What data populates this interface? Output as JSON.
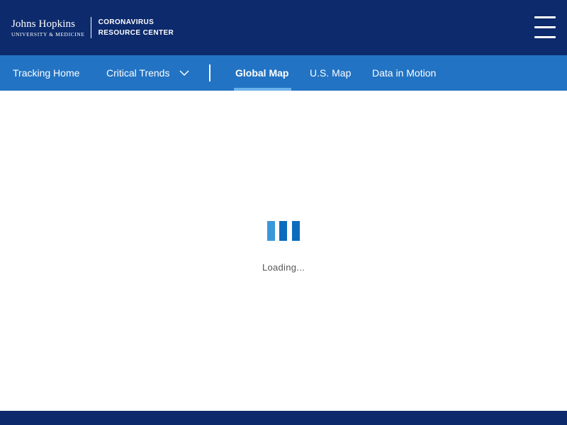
{
  "header": {
    "logo": {
      "line1": "Johns Hopkins",
      "line2": "UNIVERSITY & MEDICINE",
      "center_line1": "CORONAVIRUS",
      "center_line2": "RESOURCE CENTER"
    },
    "menu_icon": "hamburger-menu-icon"
  },
  "nav": {
    "items": [
      {
        "label": "Tracking Home"
      },
      {
        "label": "Critical Trends"
      },
      {
        "label": "Global Map"
      },
      {
        "label": "U.S. Map"
      },
      {
        "label": "Data in Motion"
      }
    ],
    "active_item": "Global Map",
    "dropdown_icon": "chevron-down-icon"
  },
  "main": {
    "loading_text": "Loading..."
  },
  "colors": {
    "header_bg": "#0c2a6c",
    "nav_bg": "#2273c3",
    "active_underline": "#6ab0ea",
    "loader_light": "#3a98d8",
    "loader_dark": "#0a6cbd"
  }
}
